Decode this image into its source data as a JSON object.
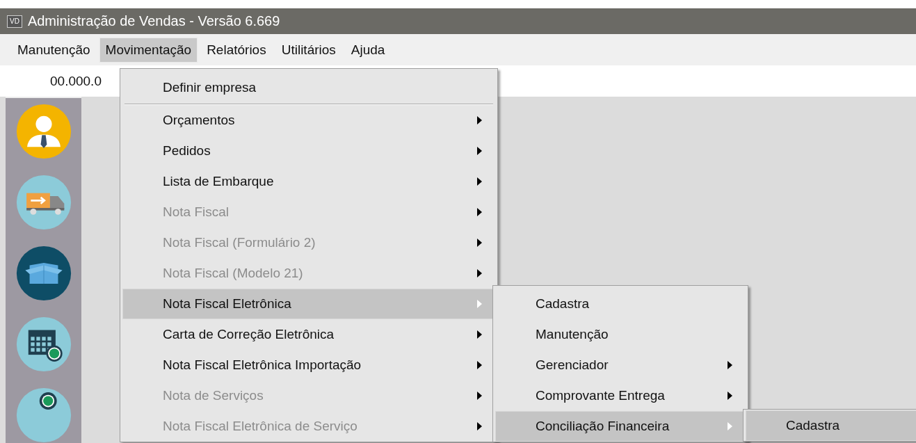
{
  "window": {
    "icon_text": "VD",
    "title": "Administração de Vendas - Versão 6.669"
  },
  "menubar": [
    {
      "label": "Manutenção",
      "selected": false
    },
    {
      "label": "Movimentação",
      "selected": true
    },
    {
      "label": "Relatórios",
      "selected": false
    },
    {
      "label": "Utilitários",
      "selected": false
    },
    {
      "label": "Ajuda",
      "selected": false
    }
  ],
  "toolbar": {
    "company_field": "00.000.0"
  },
  "menus": [
    {
      "items": [
        {
          "kind": "item",
          "label": "Definir empresa",
          "disabled": false,
          "submenu": false,
          "selected": false
        },
        {
          "kind": "separator"
        },
        {
          "kind": "item",
          "label": "Orçamentos",
          "disabled": false,
          "submenu": true,
          "selected": false
        },
        {
          "kind": "item",
          "label": "Pedidos",
          "disabled": false,
          "submenu": true,
          "selected": false
        },
        {
          "kind": "item",
          "label": "Lista de Embarque",
          "disabled": false,
          "submenu": true,
          "selected": false
        },
        {
          "kind": "item",
          "label": "Nota Fiscal",
          "disabled": true,
          "submenu": true,
          "selected": false
        },
        {
          "kind": "item",
          "label": "Nota Fiscal (Formulário 2)",
          "disabled": true,
          "submenu": true,
          "selected": false
        },
        {
          "kind": "item",
          "label": "Nota Fiscal (Modelo 21)",
          "disabled": true,
          "submenu": true,
          "selected": false
        },
        {
          "kind": "item",
          "label": "Nota Fiscal Eletrônica",
          "disabled": false,
          "submenu": true,
          "selected": true
        },
        {
          "kind": "item",
          "label": "Carta de Correção Eletrônica",
          "disabled": false,
          "submenu": true,
          "selected": false
        },
        {
          "kind": "item",
          "label": "Nota Fiscal Eletrônica Importação",
          "disabled": false,
          "submenu": true,
          "selected": false
        },
        {
          "kind": "item",
          "label": "Nota de Serviços",
          "disabled": true,
          "submenu": true,
          "selected": false
        },
        {
          "kind": "item",
          "label": "Nota Fiscal Eletrônica de Serviço",
          "disabled": true,
          "submenu": true,
          "selected": false
        }
      ]
    },
    {
      "items": [
        {
          "kind": "item",
          "label": "Cadastra",
          "disabled": false,
          "submenu": false,
          "selected": false
        },
        {
          "kind": "item",
          "label": "Manutenção",
          "disabled": false,
          "submenu": false,
          "selected": false
        },
        {
          "kind": "item",
          "label": "Gerenciador",
          "disabled": false,
          "submenu": true,
          "selected": false
        },
        {
          "kind": "item",
          "label": "Comprovante Entrega",
          "disabled": false,
          "submenu": true,
          "selected": false
        },
        {
          "kind": "item",
          "label": "Conciliação Financeira",
          "disabled": false,
          "submenu": true,
          "selected": true
        }
      ]
    },
    {
      "items": [
        {
          "kind": "item",
          "label": "Cadastra",
          "disabled": false,
          "submenu": false,
          "selected": true
        }
      ]
    }
  ]
}
